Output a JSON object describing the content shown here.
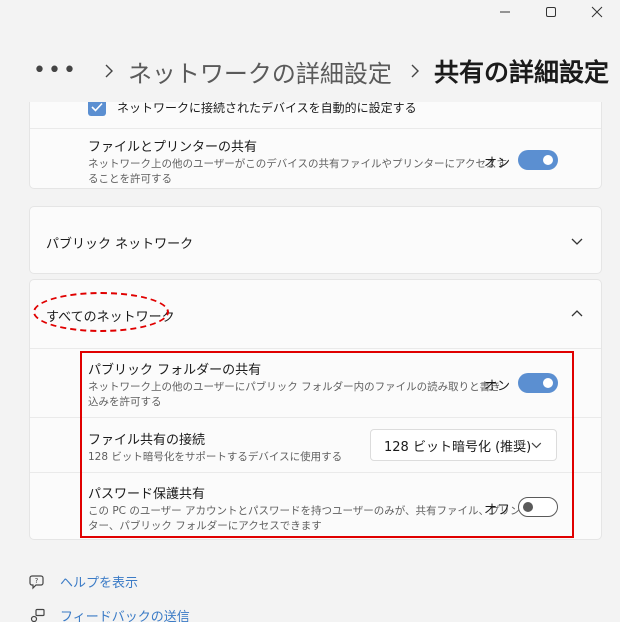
{
  "window": {
    "minimize_icon": "minimize-icon",
    "maximize_icon": "maximize-icon",
    "close_icon": "close-icon"
  },
  "breadcrumb": {
    "more": "•••",
    "previous": "ネットワークの詳細設定",
    "current": "共有の詳細設定"
  },
  "private_section": {
    "auto_setup_label": "ネットワークに接続されたデバイスを自動的に設定する",
    "auto_setup_checked": true,
    "file_printer_title": "ファイルとプリンターの共有",
    "file_printer_desc_1": "ネットワーク上の他のユーザーがこのデバイスの共有ファイルやプリンターにアクセスす",
    "file_printer_desc_2": "ることを許可する",
    "file_printer_state": "オン",
    "file_printer_on": true
  },
  "public_section": {
    "title": "パブリック ネットワーク",
    "expanded": false
  },
  "all_networks": {
    "title": "すべてのネットワーク",
    "expanded": true,
    "public_folder_title": "パブリック フォルダーの共有",
    "public_folder_desc_1": "ネットワーク上の他のユーザーにパブリック フォルダー内のファイルの読み取りと書き",
    "public_folder_desc_2": "込みを許可する",
    "public_folder_state": "オン",
    "public_folder_on": true,
    "file_sharing_title": "ファイル共有の接続",
    "file_sharing_desc": "128 ビット暗号化をサポートするデバイスに使用する",
    "file_sharing_value": "128 ビット暗号化 (推奨)",
    "password_title": "パスワード保護共有",
    "password_desc_1": "この PC のユーザー アカウントとパスワードを持つユーザーのみが、共有ファイル、プリン",
    "password_desc_2": "ター、パブリック フォルダーにアクセスできます",
    "password_state": "オフ",
    "password_on": false
  },
  "footer": {
    "help_label": "ヘルプを表示",
    "feedback_label": "フィードバックの送信"
  },
  "colors": {
    "accent": "#5b8fd1",
    "annotation": "#e00000",
    "link": "#3b7bc6"
  }
}
